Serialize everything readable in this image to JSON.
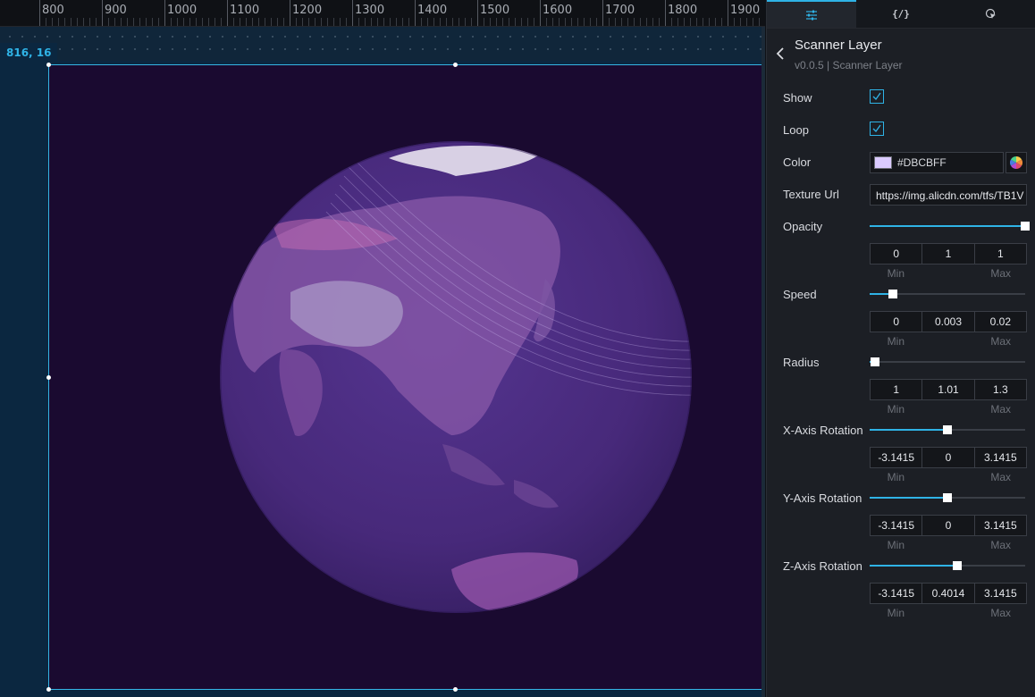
{
  "ruler": {
    "labels": [
      "800",
      "900",
      "1000",
      "1100",
      "1200",
      "1300",
      "1400",
      "1500",
      "1600",
      "1700",
      "1800",
      "1900"
    ]
  },
  "canvas": {
    "coord_readout": "816, 16"
  },
  "tabs": [
    {
      "name": "config-tab",
      "icon": "sliders-icon",
      "active": true
    },
    {
      "name": "code-tab",
      "icon": "code-braces-icon",
      "label": "{/}"
    },
    {
      "name": "interaction-tab",
      "icon": "cursor-click-icon"
    }
  ],
  "header": {
    "title": "Scanner Layer",
    "subtitle": "v0.0.5 | Scanner Layer"
  },
  "props": {
    "show": {
      "label": "Show",
      "checked": true
    },
    "loop": {
      "label": "Loop",
      "checked": true
    },
    "color": {
      "label": "Color",
      "value": "#DBCBFF"
    },
    "texture": {
      "label": "Texture Url",
      "value": "https://img.alicdn.com/tfs/TB1V"
    },
    "caption_min": "Min",
    "caption_max": "Max",
    "opacity": {
      "label": "Opacity",
      "min": "0",
      "value": "1",
      "max": "1",
      "level": 1.0
    },
    "speed": {
      "label": "Speed",
      "min": "0",
      "value": "0.003",
      "max": "0.02",
      "level": 0.15
    },
    "radius": {
      "label": "Radius",
      "min": "1",
      "value": "1.01",
      "max": "1.3",
      "level": 0.033
    },
    "xrot": {
      "label": "X-Axis Rotation",
      "min": "-3.1415",
      "value": "0",
      "max": "3.1415",
      "level": 0.5
    },
    "yrot": {
      "label": "Y-Axis Rotation",
      "min": "-3.1415",
      "value": "0",
      "max": "3.1415",
      "level": 0.5
    },
    "zrot": {
      "label": "Z-Axis Rotation",
      "min": "-3.1415",
      "value": "0.4014",
      "max": "3.1415",
      "level": 0.564
    }
  },
  "colors": {
    "accent": "#2fb3e6",
    "stage_bg": "#1a0a30",
    "globe": "#4b2d7f",
    "swatch": "#DBCBFF"
  }
}
